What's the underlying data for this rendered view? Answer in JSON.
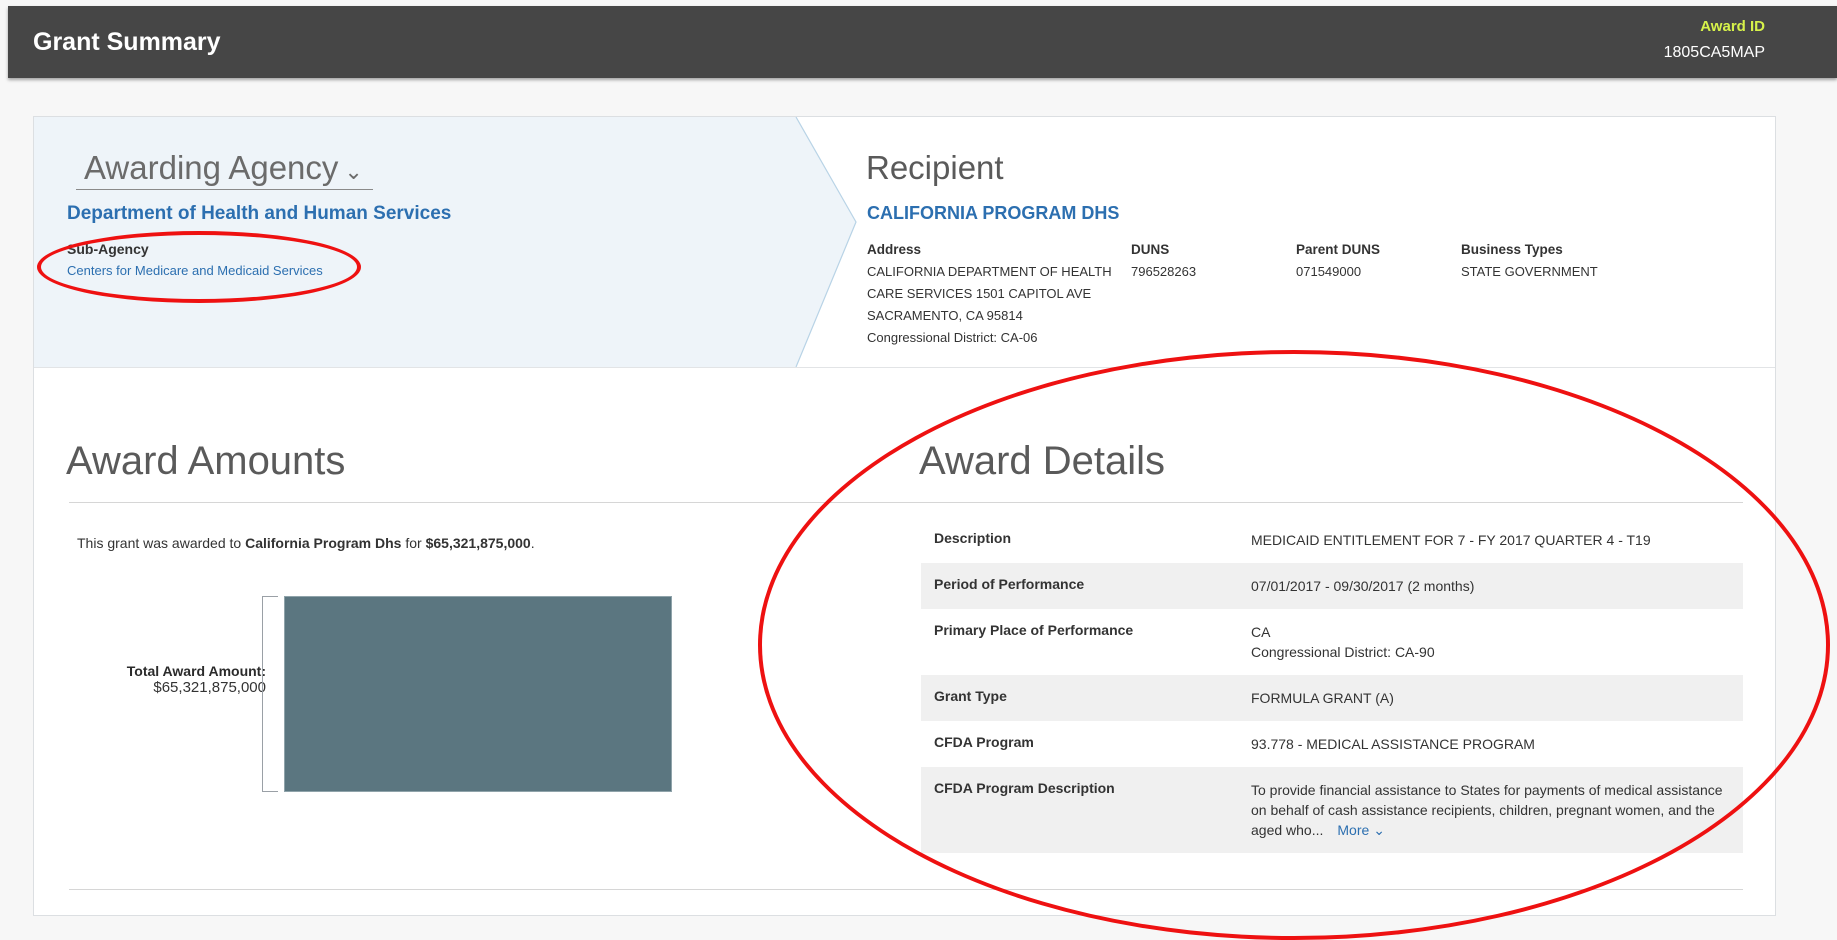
{
  "header": {
    "title": "Grant Summary",
    "award_id_label": "Award ID",
    "award_id": "1805CA5MAP"
  },
  "agency": {
    "heading": "Awarding Agency",
    "name": "Department of Health and Human Services",
    "sub_agency_label": "Sub-Agency",
    "sub_agency": "Centers for Medicare and Medicaid Services"
  },
  "recipient": {
    "heading": "Recipient",
    "name": "CALIFORNIA PROGRAM DHS",
    "address_label": "Address",
    "address_lines": [
      "CALIFORNIA DEPARTMENT OF HEALTH",
      "CARE SERVICES 1501 CAPITOL AVE",
      "SACRAMENTO, CA 95814",
      "Congressional District: CA-06"
    ],
    "duns_label": "DUNS",
    "duns": "796528263",
    "parent_duns_label": "Parent DUNS",
    "parent_duns": "071549000",
    "business_types_label": "Business Types",
    "business_types": "STATE GOVERNMENT"
  },
  "amounts": {
    "heading": "Award Amounts",
    "sentence_prefix": "This grant was awarded to ",
    "sentence_recipient": "California Program Dhs",
    "sentence_mid": " for ",
    "sentence_amount": "$65,321,875,000",
    "sentence_suffix": ".",
    "total_label": "Total Award Amount:",
    "total_value": "$65,321,875,000"
  },
  "details": {
    "heading": "Award Details",
    "rows": [
      {
        "label": "Description",
        "value": "MEDICAID ENTITLEMENT FOR 7 - FY 2017 QUARTER 4 - T19"
      },
      {
        "label": "Period of Performance",
        "value": "07/01/2017 - 09/30/2017 (2 months)"
      },
      {
        "label": "Primary Place of Performance",
        "value": "CA",
        "value2": "Congressional District: CA-90"
      },
      {
        "label": "Grant Type",
        "value": "FORMULA GRANT (A)"
      },
      {
        "label": "CFDA Program",
        "value": "93.778 - MEDICAL ASSISTANCE PROGRAM"
      },
      {
        "label": "CFDA Program Description",
        "value": "To provide financial assistance to States for payments of medical assistance on behalf of cash assistance recipients, children, pregnant women, and the aged who...",
        "more": "More"
      }
    ]
  },
  "colors": {
    "header_bg": "#464646",
    "award_id_accent": "#d7f24a",
    "link_blue": "#2c6fb0",
    "bar_fill": "#5b7680",
    "annotation_red": "#e11111"
  }
}
